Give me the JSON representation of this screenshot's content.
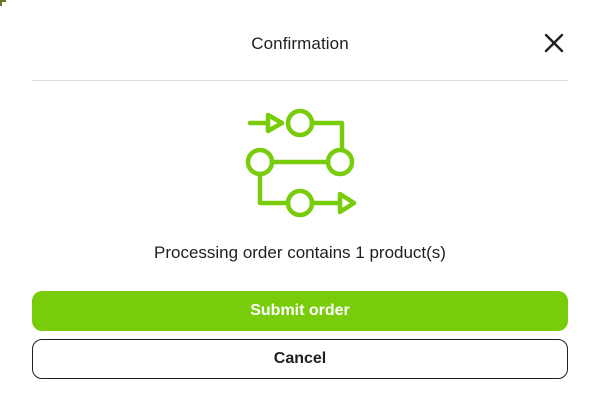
{
  "dialog": {
    "title": "Confirmation",
    "close_icon": "close-icon",
    "illustration_icon": "process-flow-icon",
    "message": "Processing order contains 1 product(s)",
    "submit_label": "Submit order",
    "cancel_label": "Cancel"
  },
  "colors": {
    "accent": "#78cc0a",
    "text": "#1f1f1f",
    "divider": "#d9d9d9",
    "background": "#ffffff"
  }
}
